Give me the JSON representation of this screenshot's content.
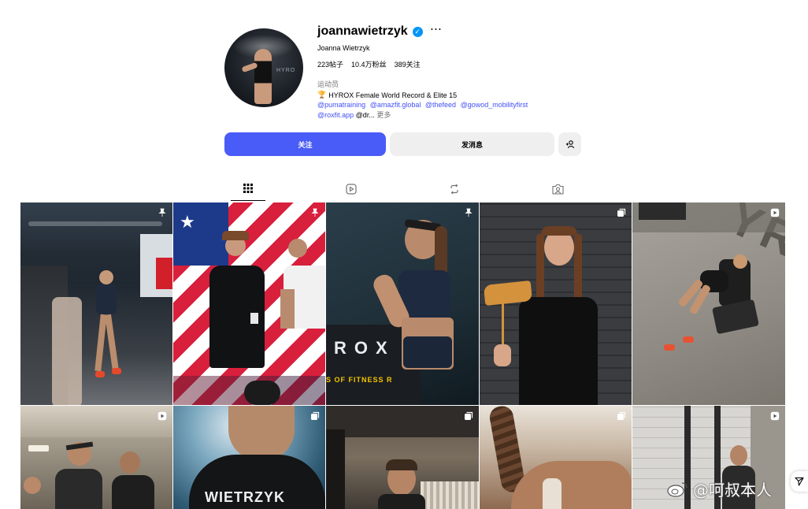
{
  "profile": {
    "username": "joannawietrzyk",
    "more_label": "···",
    "full_name": "Joanna Wietrzyk",
    "stats": [
      {
        "value": "223",
        "label": "帖子"
      },
      {
        "value": "10.4万",
        "label": "粉丝"
      },
      {
        "value": "389",
        "label": "关注"
      }
    ],
    "category": "运动员",
    "bio_line": "HYROX Female World Record & Elite 15",
    "mentions": [
      "@pumatraining",
      "@amazfit.global",
      "@thefeed",
      "@gowod_mobilityfirst"
    ],
    "mention_last": "@roxfit.app",
    "mention_truncated": "@dr...",
    "more_link": "更多",
    "avatar_text": "HYRO"
  },
  "actions": {
    "follow": "关注",
    "message": "发消息"
  },
  "tabs": [
    {
      "icon": "grid-icon",
      "active": true
    },
    {
      "icon": "reels-icon",
      "active": false
    },
    {
      "icon": "reposts-icon",
      "active": false
    },
    {
      "icon": "tagged-icon",
      "active": false
    }
  ],
  "posts": [
    {
      "badge": "pin-icon"
    },
    {
      "badge": "pin-icon"
    },
    {
      "badge": "pin-icon"
    },
    {
      "badge": "carousel-icon"
    },
    {
      "badge": "reel-icon"
    },
    {
      "badge": "reel-icon"
    },
    {
      "badge": "carousel-icon"
    },
    {
      "badge": "carousel-icon"
    },
    {
      "badge": "carousel-icon"
    },
    {
      "badge": "reel-icon"
    }
  ],
  "post_texts": {
    "rox": "ROX",
    "fitness": "S OF FITNESS R",
    "hyrox_floor": "YRO",
    "wietrzyk": "WIETRZYK"
  },
  "watermark": "@呵叔本人",
  "colors": {
    "accent": "#4a5cf7",
    "link": "#4150f7",
    "verified": "#0095f6"
  }
}
